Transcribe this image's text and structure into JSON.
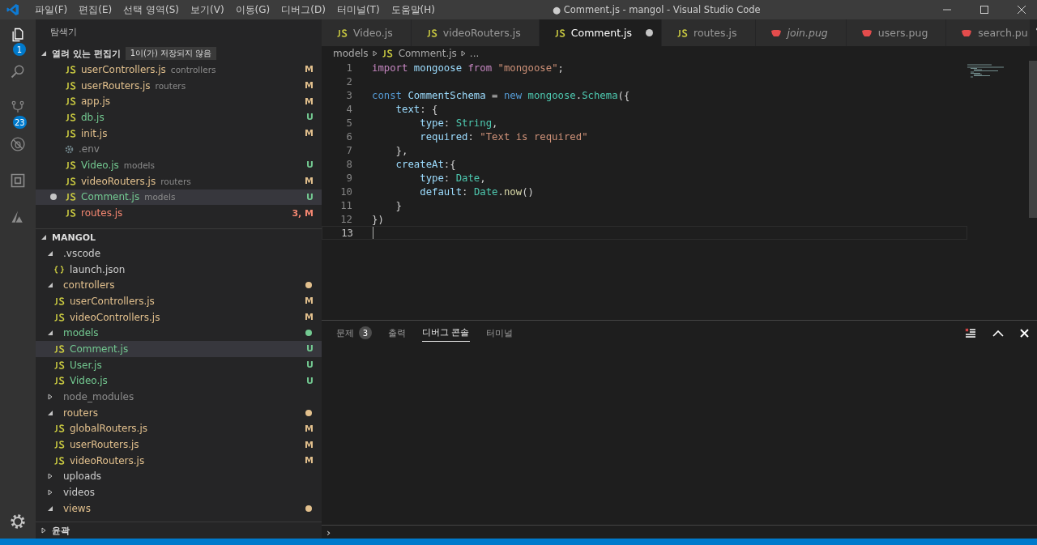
{
  "menu": [
    "파일(F)",
    "편집(E)",
    "선택 영역(S)",
    "보기(V)",
    "이동(G)",
    "디버그(D)",
    "터미널(T)",
    "도움말(H)"
  ],
  "window": {
    "title": "● Comment.js - mangol - Visual Studio Code"
  },
  "activity_bar": [
    {
      "kind": "files",
      "badge": "1",
      "selected": true
    },
    {
      "kind": "search",
      "selected": false
    },
    {
      "kind": "scm",
      "badge": "23",
      "selected": false
    },
    {
      "kind": "debug",
      "selected": false
    },
    {
      "kind": "extensions",
      "selected": false
    },
    {
      "kind": "azure",
      "selected": false
    }
  ],
  "sidebar": {
    "title": "탐색기",
    "open_editors": {
      "title": "열려 있는 편집기",
      "badge": "1이(가) 저장되지 않음",
      "expanded": true,
      "items": [
        {
          "name": "userControllers.js",
          "dir": "controllers",
          "status": "M",
          "color": "#e2c08d",
          "kind": "js",
          "dirty": false,
          "selected": false
        },
        {
          "name": "userRouters.js",
          "dir": "routers",
          "status": "M",
          "color": "#e2c08d",
          "kind": "js",
          "dirty": false,
          "selected": false
        },
        {
          "name": "app.js",
          "status": "M",
          "color": "#e2c08d",
          "kind": "js",
          "dirty": false,
          "selected": false
        },
        {
          "name": "db.js",
          "status": "U",
          "color": "#73c991",
          "kind": "js",
          "dirty": false,
          "selected": false
        },
        {
          "name": "init.js",
          "status": "M",
          "color": "#e2c08d",
          "kind": "js",
          "dirty": false,
          "selected": false
        },
        {
          "name": ".env",
          "color": "#8c8c8c",
          "kind": "gear",
          "dirty": false,
          "selected": false
        },
        {
          "name": "Video.js",
          "dir": "models",
          "status": "U",
          "color": "#73c991",
          "kind": "js",
          "dirty": false,
          "selected": false
        },
        {
          "name": "videoRouters.js",
          "dir": "routers",
          "status": "M",
          "color": "#e2c08d",
          "kind": "js",
          "dirty": false,
          "selected": false
        },
        {
          "name": "Comment.js",
          "dir": "models",
          "status": "U",
          "color": "#73c991",
          "kind": "js",
          "dirty": true,
          "selected": true
        },
        {
          "name": "routes.js",
          "status": "3, M",
          "color": "#f48771",
          "kind": "js",
          "dirty": false,
          "selected": false
        }
      ]
    },
    "project": {
      "title": "MANGOL",
      "expanded": true,
      "tree": [
        {
          "name": ".vscode",
          "kind": "folder",
          "expanded": true,
          "color": "#cccccc",
          "changed": false,
          "selected": false,
          "children": [
            {
              "name": "launch.json",
              "kind": "json",
              "color": "#cccccc",
              "selected": false
            }
          ]
        },
        {
          "name": "controllers",
          "kind": "folder",
          "expanded": true,
          "color": "#e2c08d",
          "changed": true,
          "selected": false,
          "children": [
            {
              "name": "userControllers.js",
              "kind": "js",
              "color": "#e2c08d",
              "status": "M",
              "selected": false
            },
            {
              "name": "videoControllers.js",
              "kind": "js",
              "color": "#e2c08d",
              "status": "M",
              "selected": false
            }
          ]
        },
        {
          "name": "models",
          "kind": "folder",
          "expanded": true,
          "color": "#73c991",
          "changed": true,
          "selected": false,
          "children": [
            {
              "name": "Comment.js",
              "kind": "js",
              "color": "#73c991",
              "status": "U",
              "selected": true
            },
            {
              "name": "User.js",
              "kind": "js",
              "color": "#73c991",
              "status": "U",
              "selected": false
            },
            {
              "name": "Video.js",
              "kind": "js",
              "color": "#73c991",
              "status": "U",
              "selected": false
            }
          ]
        },
        {
          "name": "node_modules",
          "kind": "folder",
          "expanded": false,
          "color": "#8c8c8c",
          "changed": false,
          "selected": false
        },
        {
          "name": "routers",
          "kind": "folder",
          "expanded": true,
          "color": "#e2c08d",
          "changed": true,
          "selected": false,
          "children": [
            {
              "name": "globalRouters.js",
              "kind": "js",
              "color": "#e2c08d",
              "status": "M",
              "selected": false
            },
            {
              "name": "userRouters.js",
              "kind": "js",
              "color": "#e2c08d",
              "status": "M",
              "selected": false
            },
            {
              "name": "videoRouters.js",
              "kind": "js",
              "color": "#e2c08d",
              "status": "M",
              "selected": false
            }
          ]
        },
        {
          "name": "uploads",
          "kind": "folder",
          "expanded": false,
          "color": "#cccccc",
          "changed": false,
          "selected": false
        },
        {
          "name": "videos",
          "kind": "folder",
          "expanded": false,
          "color": "#cccccc",
          "changed": false,
          "selected": false
        },
        {
          "name": "views",
          "kind": "folder",
          "expanded": true,
          "color": "#e2c08d",
          "changed": true,
          "selected": false
        }
      ]
    },
    "outline": {
      "title": "윤곽",
      "expanded": false
    }
  },
  "tabs": [
    {
      "label": "Video.js",
      "kind": "js",
      "selected": false,
      "dirty": false,
      "preview": false
    },
    {
      "label": "videoRouters.js",
      "kind": "js",
      "selected": false,
      "dirty": false,
      "preview": false
    },
    {
      "label": "Comment.js",
      "kind": "js",
      "selected": true,
      "dirty": true,
      "preview": false
    },
    {
      "label": "routes.js",
      "kind": "js",
      "selected": false,
      "dirty": false,
      "preview": false
    },
    {
      "label": "join.pug",
      "kind": "pug",
      "selected": false,
      "dirty": false,
      "preview": true
    },
    {
      "label": "users.pug",
      "kind": "pug",
      "selected": false,
      "dirty": false,
      "preview": false
    },
    {
      "label": "search.pu",
      "kind": "pug",
      "selected": false,
      "dirty": false,
      "preview": false
    }
  ],
  "breadcrumb": [
    "models",
    "Comment.js",
    "..."
  ],
  "code": [
    {
      "number": "1",
      "current": false,
      "tokens": [
        {
          "t": "import ",
          "kind": "keyword"
        },
        {
          "t": "mongoose ",
          "kind": "var"
        },
        {
          "t": "from ",
          "kind": "keyword"
        },
        {
          "t": "\"mongoose\"",
          "kind": "string"
        },
        {
          "t": ";",
          "kind": "plain"
        }
      ]
    },
    {
      "number": "2",
      "current": false
    },
    {
      "number": "3",
      "current": false,
      "tokens": [
        {
          "t": "const ",
          "kind": "storage"
        },
        {
          "t": "CommentSchema",
          "kind": "var"
        },
        {
          "t": " = ",
          "kind": "plain"
        },
        {
          "t": "new ",
          "kind": "storage"
        },
        {
          "t": "mongoose",
          "kind": "type"
        },
        {
          "t": ".",
          "kind": "plain"
        },
        {
          "t": "Schema",
          "kind": "type"
        },
        {
          "t": "({",
          "kind": "plain"
        }
      ]
    },
    {
      "number": "4",
      "current": false,
      "tokens": [
        {
          "t": "    text",
          "kind": "var"
        },
        {
          "t": ": {",
          "kind": "plain"
        }
      ]
    },
    {
      "number": "5",
      "current": false,
      "tokens": [
        {
          "t": "        type",
          "kind": "var"
        },
        {
          "t": ": ",
          "kind": "plain"
        },
        {
          "t": "String",
          "kind": "type"
        },
        {
          "t": ",",
          "kind": "plain"
        }
      ]
    },
    {
      "number": "6",
      "current": false,
      "tokens": [
        {
          "t": "        required",
          "kind": "var"
        },
        {
          "t": ": ",
          "kind": "plain"
        },
        {
          "t": "\"Text is required\"",
          "kind": "string"
        }
      ]
    },
    {
      "number": "7",
      "current": false,
      "tokens": [
        {
          "t": "    },",
          "kind": "plain"
        }
      ]
    },
    {
      "number": "8",
      "current": false,
      "tokens": [
        {
          "t": "    createAt",
          "kind": "var"
        },
        {
          "t": ":{",
          "kind": "plain"
        }
      ]
    },
    {
      "number": "9",
      "current": false,
      "tokens": [
        {
          "t": "        type",
          "kind": "var"
        },
        {
          "t": ": ",
          "kind": "plain"
        },
        {
          "t": "Date",
          "kind": "type"
        },
        {
          "t": ",",
          "kind": "plain"
        }
      ]
    },
    {
      "number": "10",
      "current": false,
      "tokens": [
        {
          "t": "        default",
          "kind": "var"
        },
        {
          "t": ": ",
          "kind": "plain"
        },
        {
          "t": "Date",
          "kind": "type"
        },
        {
          "t": ".",
          "kind": "plain"
        },
        {
          "t": "now",
          "kind": "func"
        },
        {
          "t": "()",
          "kind": "plain"
        }
      ]
    },
    {
      "number": "11",
      "current": false,
      "tokens": [
        {
          "t": "    }",
          "kind": "plain"
        }
      ]
    },
    {
      "number": "12",
      "current": false,
      "tokens": [
        {
          "t": "})",
          "kind": "plain"
        }
      ]
    },
    {
      "number": "13",
      "current": true
    }
  ],
  "panel": {
    "tabs": [
      {
        "label": "문제",
        "badge": "3",
        "selected": false
      },
      {
        "label": "출력",
        "selected": false
      },
      {
        "label": "디버그 콘솔",
        "selected": true
      },
      {
        "label": "터미널",
        "selected": false
      }
    ],
    "prompt": "›"
  }
}
